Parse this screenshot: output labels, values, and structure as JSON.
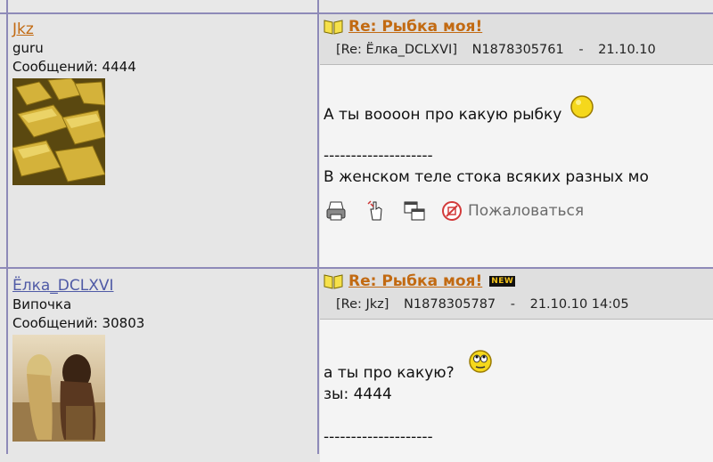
{
  "posts": [
    {
      "author": "Jkz",
      "author_color": "#c26a12",
      "rank": "guru",
      "messages_label": "Сообщений: 4444",
      "title": "Re: Рыбка моя!",
      "reply_to": "[Re: Ёлка_DCLXVI]",
      "post_id": "N1878305761",
      "datetime": "21.10.10",
      "lines": [
        "А ты воооон про какую рыбку"
      ],
      "separator": "--------------------",
      "signature": "В женском теле стока всяких разных мо",
      "report_label": "Пожаловаться",
      "emoticon": "yellow-smiley-icon"
    },
    {
      "author": "Ёлка_DCLXVI",
      "author_color": "#4f5aa6",
      "rank": "Випочка",
      "messages_label": "Сообщений: 30803",
      "title": "Re: Рыбка моя!",
      "new_badge": "NEW",
      "reply_to": "[Re: Jkz]",
      "post_id": "N1878305787",
      "datetime": "21.10.10 14:05",
      "lines": [
        "а ты про какую?",
        "зы: 4444"
      ],
      "separator": "--------------------",
      "emoticon": "rolling-eyes-smiley-icon"
    }
  ]
}
